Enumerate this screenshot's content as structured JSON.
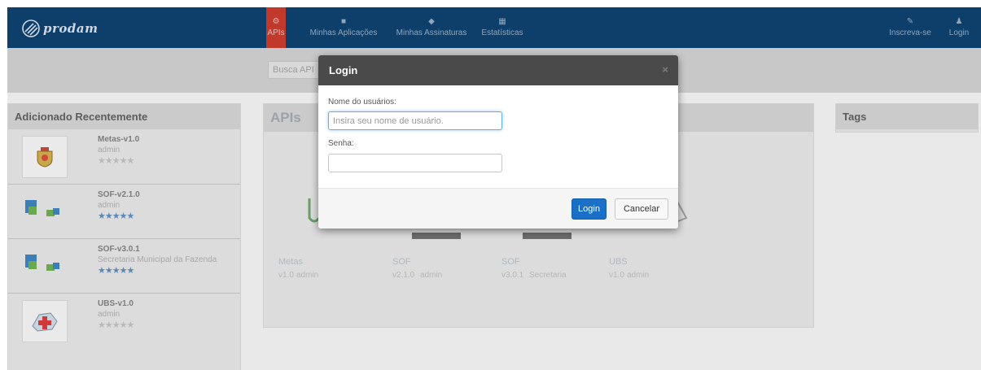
{
  "nav": {
    "logo_text": "prodam",
    "items": [
      {
        "label": "APIs",
        "icon": "gears-icon"
      },
      {
        "label": "Minhas Aplicações",
        "icon": "briefcase-icon"
      },
      {
        "label": "Minhas Assinaturas",
        "icon": "tag-icon"
      },
      {
        "label": "Estatísticas",
        "icon": "chart-icon"
      }
    ],
    "right": [
      {
        "label": "Inscreva-se",
        "icon": "edit-icon"
      },
      {
        "label": "Login",
        "icon": "user-icon"
      }
    ]
  },
  "search": {
    "placeholder": "Busca API"
  },
  "recent": {
    "title": "Adicionado Recentemente",
    "items": [
      {
        "name": "Metas-v1.0",
        "owner": "admin",
        "stars": "★★★★★"
      },
      {
        "name": "SOF-v2.1.0",
        "owner": "admin",
        "stars": "★★★★★"
      },
      {
        "name": "SOF-v3.0.1",
        "owner": "Secretaria Municipal da Fazenda",
        "stars": "★★★★★"
      },
      {
        "name": "UBS-v1.0",
        "owner": "admin",
        "stars": "★★★★★"
      }
    ]
  },
  "apis": {
    "title": "APIs",
    "cards": [
      {
        "name": "Metas",
        "version": "v1.0",
        "owner": "admin"
      },
      {
        "name": "SOF",
        "version": "v2.1.0",
        "owner": "admin"
      },
      {
        "name": "SOF",
        "version": "v3.0.1",
        "owner": "Secretaria"
      },
      {
        "name": "UBS",
        "version": "v1.0",
        "owner": "admin"
      }
    ]
  },
  "tags": {
    "title": "Tags"
  },
  "modal": {
    "title": "Login",
    "close": "×",
    "username_label": "Nome do usuários:",
    "username_placeholder": "Insira seu nome de usuário.",
    "password_label": "Senha:",
    "login_button": "Login",
    "cancel_button": "Cancelar"
  },
  "colors": {
    "nav_bg": "#0e3f6b",
    "nav_active": "#c0392b",
    "primary_button": "#1a6fc9",
    "modal_header": "#4a4a4a"
  }
}
